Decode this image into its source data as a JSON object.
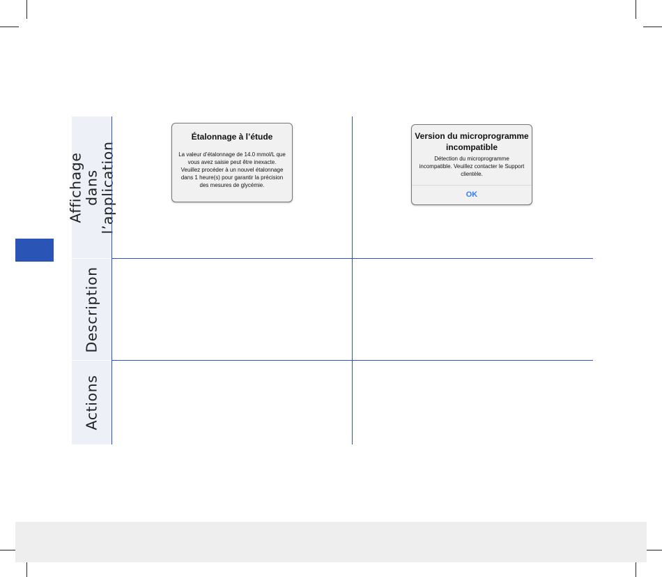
{
  "table": {
    "rows": [
      {
        "label": "Affichage dans\nl’application"
      },
      {
        "label": "Description"
      },
      {
        "label": "Actions"
      }
    ]
  },
  "dialogs": {
    "calibration": {
      "title": "Étalonnage à l’étude",
      "body": "La valeur d’étalonnage de 14.0 mmol/L que vous avez saisie peut être inexacte. Veuillez procéder à un nouvel étalonnage dans 1 heure(s) pour garantir la précision des mesures de glycémie."
    },
    "firmware": {
      "title": "Version du microprogramme incompatible",
      "body": "Détection du microprogramme incompatible. Veuillez contacter le Support clientèle.",
      "ok_label": "OK"
    }
  },
  "colors": {
    "accent": "#2a54b6",
    "header_bg": "#eef0f8",
    "ok_button": "#2f7df6",
    "footer_band": "#eeeeee"
  }
}
